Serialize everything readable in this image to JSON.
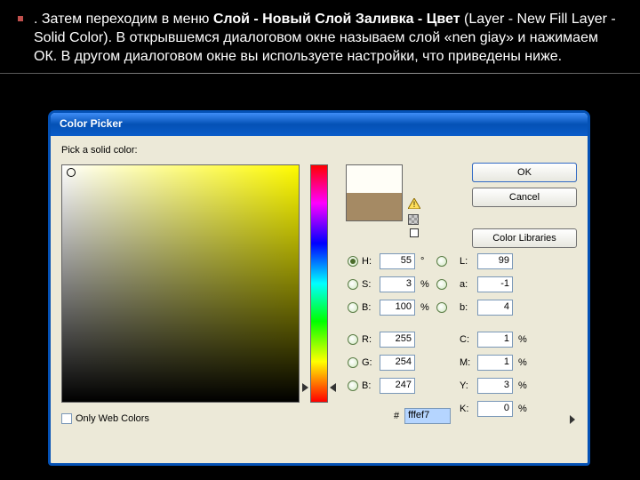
{
  "slide": {
    "text_prefix": ". Затем переходим в меню ",
    "bold1": "Слой - Новый Слой Заливка - Цвет ",
    "paren": "(Layer - New Fill Layer - Solid Color)",
    "text_suffix": ". В открывшемся диалоговом окне называем слой «nen giay» и нажимаем ОК. В другом диалоговом окне вы используете настройки, что приведены ниже."
  },
  "dialog": {
    "title": "Color Picker",
    "pick_label": "Pick a solid color:",
    "buttons": {
      "ok": "OK",
      "cancel": "Cancel",
      "libraries": "Color Libraries"
    },
    "hsb": {
      "h_label": "H:",
      "h_value": "55",
      "h_unit": "°",
      "s_label": "S:",
      "s_value": "3",
      "s_unit": "%",
      "b_label": "B:",
      "b_value": "100",
      "b_unit": "%"
    },
    "lab": {
      "l_label": "L:",
      "l_value": "99",
      "a_label": "a:",
      "a_value": "-1",
      "b_label": "b:",
      "b_value": "4"
    },
    "rgb": {
      "r_label": "R:",
      "r_value": "255",
      "g_label": "G:",
      "g_value": "254",
      "b_label": "B:",
      "b_value": "247"
    },
    "cmyk": {
      "c_label": "C:",
      "c_value": "1",
      "unit": "%",
      "m_label": "M:",
      "m_value": "1",
      "y_label": "Y:",
      "y_value": "3",
      "k_label": "K:",
      "k_value": "0"
    },
    "hex_label": "#",
    "hex_value": "fffef7",
    "web_colors": "Only Web Colors",
    "preview_new": "#fffef7",
    "preview_old": "#a58a64"
  }
}
